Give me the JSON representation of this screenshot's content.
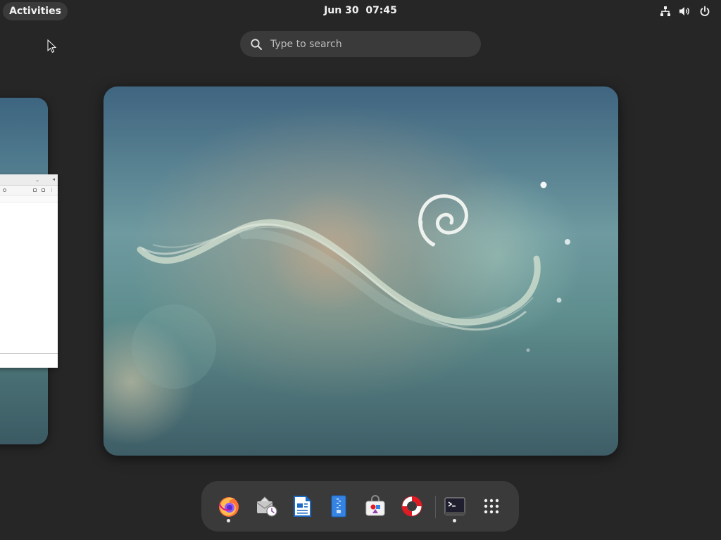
{
  "topbar": {
    "activities_label": "Activities",
    "date": "Jun 30",
    "time": "07:45",
    "tray_icons": [
      "network-icon",
      "volume-icon",
      "power-icon"
    ]
  },
  "search": {
    "placeholder": "Type to search"
  },
  "workspaces": [
    {
      "name": "workspace-1",
      "has_window": true
    },
    {
      "name": "workspace-2",
      "wallpaper": "debian-swirl",
      "active": true
    }
  ],
  "dock": {
    "apps": [
      {
        "name": "firefox",
        "running": true
      },
      {
        "name": "evolution",
        "running": false
      },
      {
        "name": "libreoffice-writer",
        "running": false
      },
      {
        "name": "files",
        "running": false
      },
      {
        "name": "software",
        "running": false
      },
      {
        "name": "help",
        "running": false
      },
      {
        "name": "terminal",
        "running": true
      },
      {
        "name": "show-apps",
        "running": false
      }
    ]
  },
  "colors": {
    "background": "#262626",
    "panel": "#3a3a3a",
    "text": "#f2f2f2"
  }
}
